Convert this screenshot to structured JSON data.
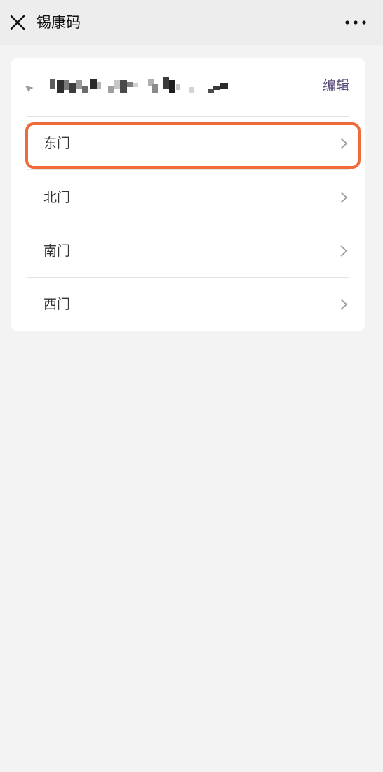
{
  "header": {
    "title": "锡康码",
    "close_icon": "close-icon",
    "more_icon": "more-horizontal-icon"
  },
  "card": {
    "location_icon": "location-pin-icon",
    "edit_label": "编辑",
    "gates": [
      {
        "label": "东门",
        "highlighted": true
      },
      {
        "label": "北门",
        "highlighted": false
      },
      {
        "label": "南门",
        "highlighted": false
      },
      {
        "label": "西门",
        "highlighted": false
      }
    ]
  },
  "colors": {
    "highlight": "#f06a3a",
    "edit_link": "#5a4a7a",
    "page_background": "#f3f3f3",
    "topbar_background": "#ededed"
  }
}
